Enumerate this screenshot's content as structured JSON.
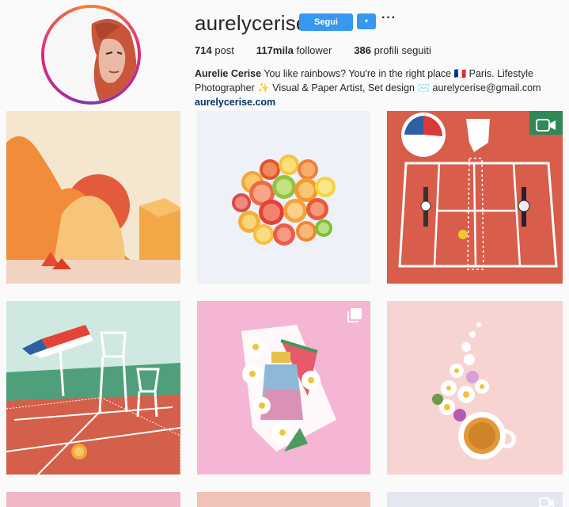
{
  "profile": {
    "username": "aurelycerise",
    "follow_label": "Segui",
    "dropdown_label": "▾",
    "more_label": "···",
    "stats": {
      "posts_count": "714",
      "posts_label": "post",
      "followers_count": "117mila",
      "followers_label": "follower",
      "following_count": "386",
      "following_label": "profili seguiti"
    },
    "bio": {
      "name": "Aurelie Cerise",
      "line1": " You like rainbows? You're in the right place 🇫🇷 Paris. Lifestyle",
      "line2": "Photographer ✨ Visual & Paper Artist, Set design ✉️ aurelycerise@gmail.com",
      "link": "aurelycerise.com"
    }
  },
  "grid": {
    "posts": [
      {
        "subject": "paper-landscape",
        "badge": "none"
      },
      {
        "subject": "citrus-slices",
        "badge": "none"
      },
      {
        "subject": "tennis-court-watches",
        "badge": "video-icon"
      },
      {
        "subject": "paper-tennis-court",
        "badge": "none"
      },
      {
        "subject": "perfume-watermelon",
        "badge": "multiple-icon"
      },
      {
        "subject": "flowers-tea",
        "badge": "none"
      },
      {
        "subject": "partial-post-7",
        "badge": "none"
      },
      {
        "subject": "partial-post-8",
        "badge": "none"
      },
      {
        "subject": "partial-post-9",
        "badge": "video-icon"
      }
    ]
  },
  "colors": {
    "accent": "#3897f0",
    "link": "#003569"
  }
}
